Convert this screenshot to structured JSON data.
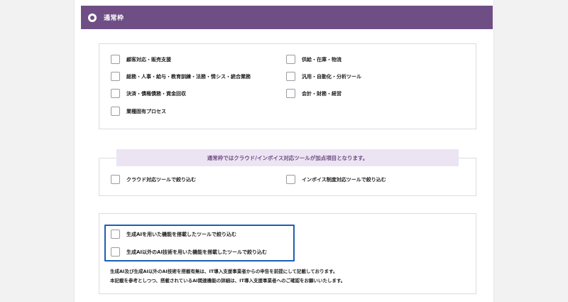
{
  "header": {
    "title": "通常枠"
  },
  "category_group": {
    "left": [
      {
        "label": "顧客対応・販売支援"
      },
      {
        "label": "総務・人事・給与・教育訓練・法務・情シス・統合業務"
      },
      {
        "label": "決済・債権債務・資金回収"
      },
      {
        "label": "業種固有プロセス"
      }
    ],
    "right": [
      {
        "label": "供給・在庫・物流"
      },
      {
        "label": "汎用・自動化・分析ツール"
      },
      {
        "label": "会計・財務・経営"
      }
    ]
  },
  "bonus_group": {
    "notice": "通常枠ではクラウド/インボイス対応ツールが加点項目となります。",
    "cloud_label": "クラウド対応ツールで絞り込む",
    "invoice_label": "インボイス制度対応ツールで絞り込む"
  },
  "ai_group": {
    "genai_label": "生成AIを用いた機能を搭載したツールで絞り込む",
    "other_ai_label": "生成AI以外のAI技術を用いた機能を搭載したツールで絞り込む",
    "note_line1": "生成AI及び生成AI以外のAI技術を搭載有無は、IT導入支援事業者からの申告を前提にして記載しております。",
    "note_line2": "本記載を参考としつつ、搭載されているAI関連機能の詳細は、IT導入支援事業者へのご確認をお願いいたします。"
  },
  "colors": {
    "accent": "#6f4e85",
    "notice_bg": "#ece4f2",
    "highlight": "#1d5fb3"
  }
}
